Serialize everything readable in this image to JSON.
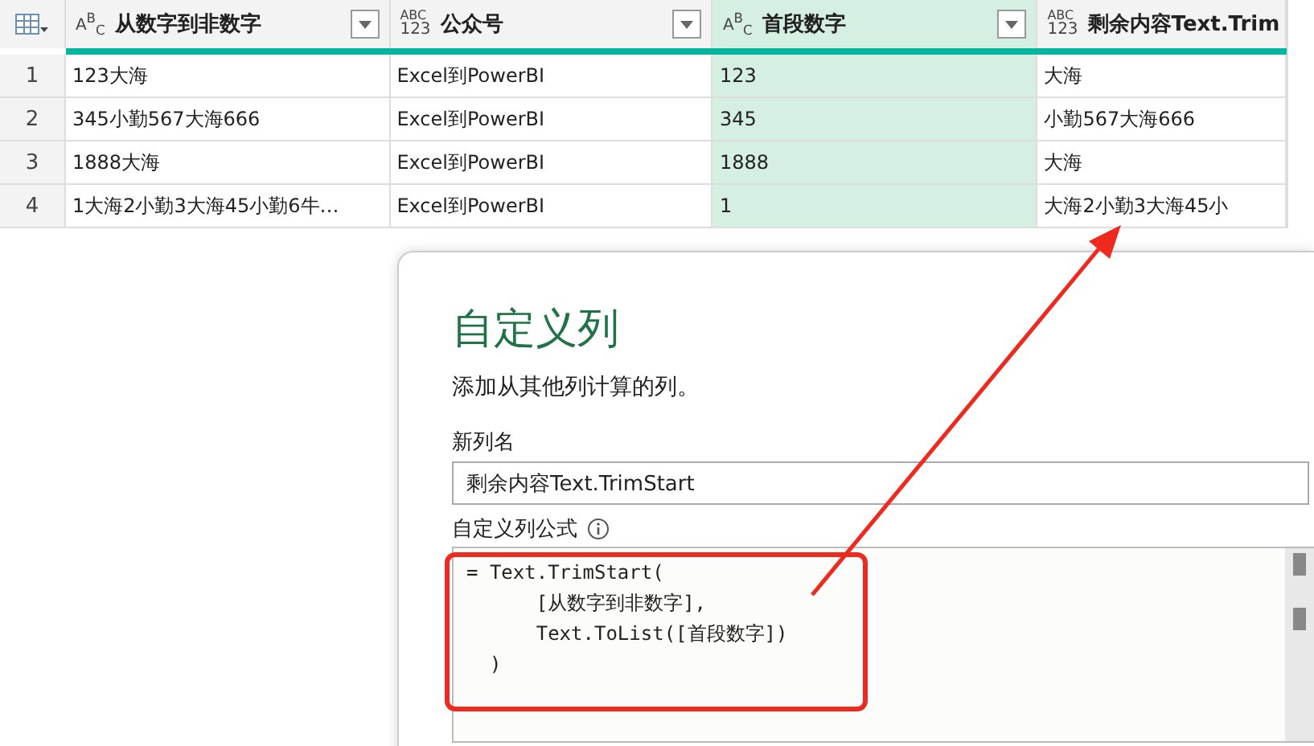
{
  "table": {
    "columns": [
      {
        "label": "从数字到非数字",
        "type_icon": {
          "kind": "text",
          "text": "A$^{B}$$_{C}$"
        },
        "filter": true,
        "selected": false
      },
      {
        "label": "公众号",
        "type_icon": {
          "kind": "any",
          "lines": [
            "ABC",
            "123"
          ]
        },
        "filter": true,
        "selected": false
      },
      {
        "label": "首段数字",
        "type_icon": {
          "kind": "text",
          "text": "A$^{B}$$_{C}$"
        },
        "filter": true,
        "selected": true
      },
      {
        "label": "剩余内容Text.Trim",
        "type_icon": {
          "kind": "any",
          "lines": [
            "ABC",
            "123"
          ]
        },
        "filter": false,
        "selected": false
      }
    ],
    "rows": [
      {
        "index": "1",
        "cells": [
          "123大海",
          "Excel到PowerBI",
          "123",
          "大海"
        ]
      },
      {
        "index": "2",
        "cells": [
          "345小勤567大海666",
          "Excel到PowerBI",
          "345",
          "小勤567大海666"
        ]
      },
      {
        "index": "3",
        "cells": [
          "1888大海",
          "Excel到PowerBI",
          "1888",
          "大海"
        ]
      },
      {
        "index": "4",
        "cells": [
          "1大海2小勤3大海45小勤6牛…",
          "Excel到PowerBI",
          "1",
          "大海2小勤3大海45小"
        ]
      }
    ]
  },
  "dialog": {
    "title": "自定义列",
    "subtitle": "添加从其他列计算的列。",
    "name_label": "新列名",
    "name_value": "剩余内容Text.TrimStart",
    "formula_label": "自定义列公式",
    "formula_lines": [
      "= Text.TrimStart(",
      "      [从数字到非数字],",
      "      Text.ToList([首段数字])",
      "  )"
    ]
  },
  "annotation": {
    "kind": "box-and-arrow"
  }
}
